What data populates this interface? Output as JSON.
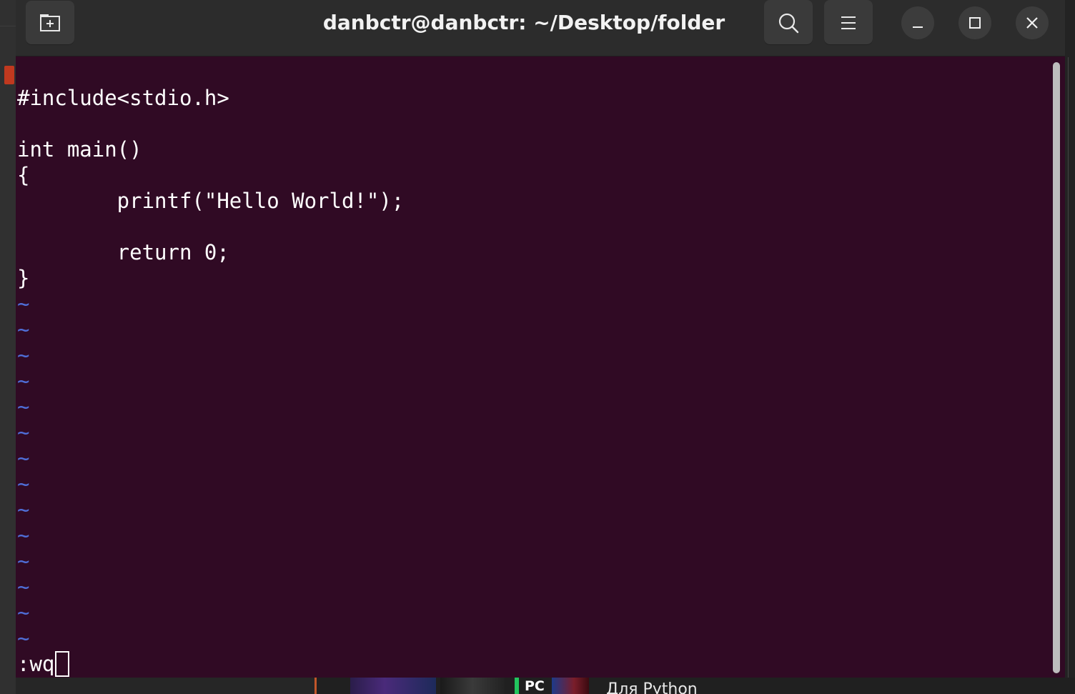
{
  "window": {
    "title": "danbctr@danbctr: ~/Desktop/folder"
  },
  "editor": {
    "lines": [
      "#include<stdio.h>",
      "",
      "int main()",
      "{",
      "        printf(\"Hello World!\");",
      "",
      "        return 0;",
      "}"
    ],
    "empty_line_marker": "~",
    "empty_line_count": 14,
    "command_line": ":wq"
  },
  "background": {
    "pc_text": "PC",
    "caption": "Для Python"
  },
  "colors": {
    "terminal_bg": "#300a24",
    "titlebar_bg": "#2c2c2c",
    "tilde": "#4f6fd8",
    "text": "#ffffff"
  },
  "icons": {
    "new_tab": "new-tab-icon",
    "search": "search-icon",
    "menu": "hamburger-menu-icon",
    "minimize": "minimize-icon",
    "maximize": "maximize-icon",
    "close": "close-icon"
  }
}
